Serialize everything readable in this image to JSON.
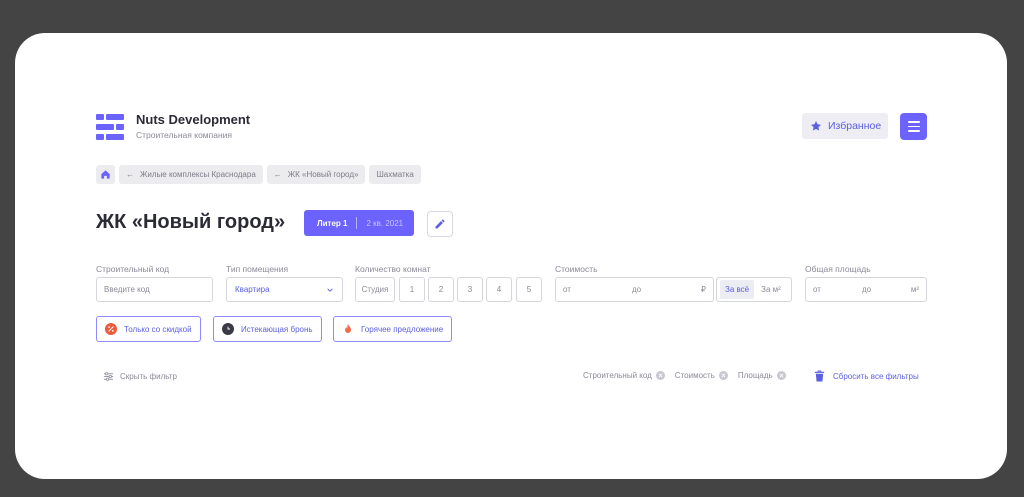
{
  "brand": {
    "title": "Nuts Development",
    "subtitle": "Строительная компания"
  },
  "header": {
    "favorites_label": "Избранное"
  },
  "breadcrumbs": [
    "Жилые комплексы Краснодара",
    "ЖК «Новый город»",
    "Шахматка"
  ],
  "page": {
    "title": "ЖК «Новый город»",
    "liter_label": "Литер 1",
    "liter_date": "2 кв. 2021"
  },
  "filters": {
    "code": {
      "label": "Строительный код",
      "placeholder": "Введите код"
    },
    "type": {
      "label": "Тип помещения",
      "value": "Квартира"
    },
    "rooms": {
      "label": "Количество комнат",
      "options": [
        "Студия",
        "1",
        "2",
        "3",
        "4",
        "5"
      ]
    },
    "price": {
      "label": "Стоимость",
      "from": "от",
      "to": "до",
      "currency": "₽",
      "toggle": [
        "За всё",
        "За м²"
      ]
    },
    "area": {
      "label": "Общая площадь",
      "from": "от",
      "to": "до",
      "unit": "м²"
    }
  },
  "tags": [
    "Только со скидкой",
    "Истекающая бронь",
    "Горячее предложение"
  ],
  "footer": {
    "hide_filter": "Скрыть фильтр",
    "active_chips": [
      "Строительный код",
      "Стоимость",
      "Площадь"
    ],
    "reset": "Сбросить все фильтры"
  },
  "colors": {
    "accent": "#6c63ff",
    "discount": "#ef5a3c",
    "clock": "#3a3a46",
    "hot": "#ef6a4a"
  }
}
